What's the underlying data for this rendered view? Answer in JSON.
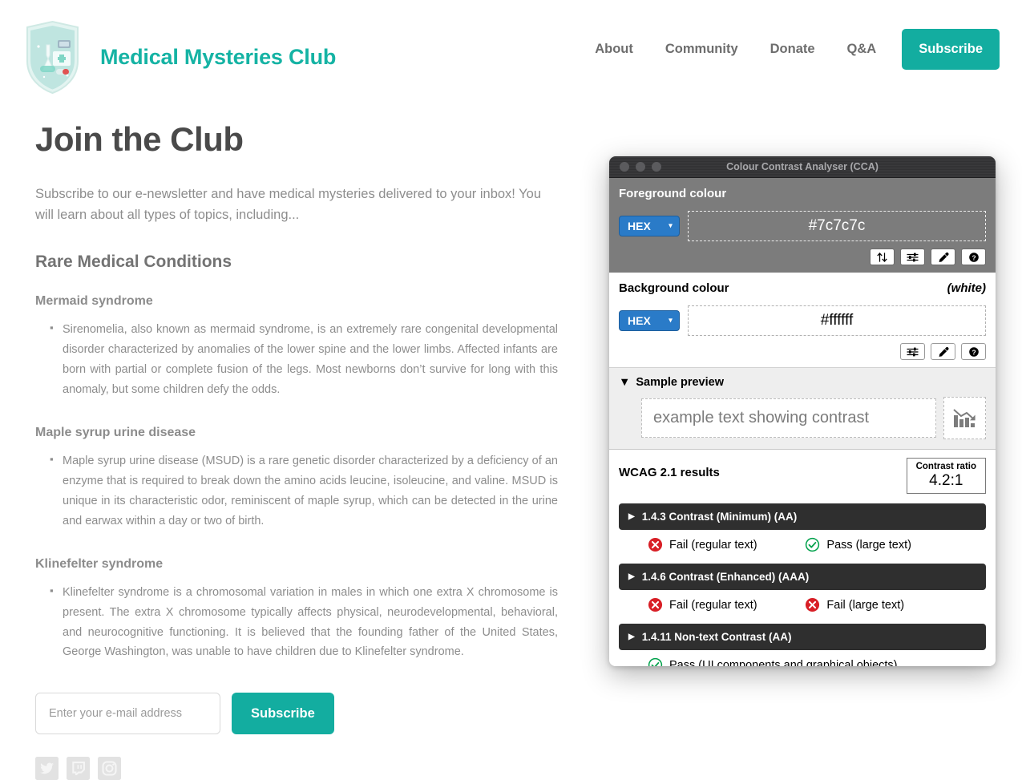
{
  "header": {
    "brand_title": "Medical Mysteries Club",
    "logo_icon": "medical-shield-logo",
    "nav": [
      {
        "label": "About"
      },
      {
        "label": "Community"
      },
      {
        "label": "Donate"
      },
      {
        "label": "Q&A"
      }
    ],
    "subscribe_button": "Subscribe",
    "accent_color": "#13ada0"
  },
  "main": {
    "page_title": "Join the Club",
    "intro": "Subscribe to our e-newsletter and have medical mysteries delivered to your inbox! You will learn about all types of topics, including...",
    "section_title": "Rare Medical Conditions",
    "conditions": [
      {
        "title": "Mermaid syndrome",
        "body": "Sirenomelia, also known as mermaid syndrome, is an extremely rare congenital developmental disorder characterized by anomalies of the lower spine and the lower limbs. Affected infants are born with partial or complete fusion of the legs. Most newborns don’t survive for long with this anomaly, but some children defy the odds."
      },
      {
        "title": "Maple syrup urine disease",
        "body": "Maple syrup urine disease (MSUD) is a rare genetic disorder characterized by a deficiency of an enzyme that is required to break down the amino acids leucine, isoleucine, and valine. MSUD is unique in its characteristic odor, reminiscent of maple syrup, which can be detected in the urine and earwax within a day or two of birth."
      },
      {
        "title": "Klinefelter syndrome",
        "body": "Klinefelter syndrome is a chromosomal variation in males in which one extra X chromosome is present. The extra X chromosome typically affects physical, neurodevelopmental, behavioral, and neurocognitive functioning. It is believed that the founding father of the United States, George Washington, was unable to have children due to Klinefelter syndrome."
      }
    ],
    "form": {
      "email_placeholder": "Enter your e-mail address",
      "email_value": "",
      "submit_label": "Subscribe"
    },
    "social": [
      {
        "name": "twitter-icon"
      },
      {
        "name": "twitch-icon"
      },
      {
        "name": "instagram-icon"
      }
    ],
    "body_text_color": "#8d8d8d"
  },
  "cca": {
    "window_title": "Colour Contrast Analyser (CCA)",
    "foreground": {
      "label": "Foreground colour",
      "format": "HEX",
      "value": "#7c7c7c",
      "buttons": [
        {
          "name": "swap-colours-icon"
        },
        {
          "name": "sliders-icon"
        },
        {
          "name": "eyedropper-icon"
        },
        {
          "name": "help-icon"
        }
      ]
    },
    "background": {
      "label": "Background colour",
      "note": "(white)",
      "format": "HEX",
      "value": "#ffffff",
      "buttons": [
        {
          "name": "sliders-icon"
        },
        {
          "name": "eyedropper-icon"
        },
        {
          "name": "help-icon"
        }
      ]
    },
    "sample": {
      "title": "Sample preview",
      "disclosure": "▼",
      "text": "example text showing contrast",
      "graphic_icon": "declining-bar-chart-icon"
    },
    "results": {
      "title": "WCAG 2.1 results",
      "ratio_label": "Contrast ratio",
      "ratio_value": "4.2:1",
      "criteria": [
        {
          "name": "1.4.3 Contrast (Minimum) (AA)",
          "outcomes": [
            {
              "status": "fail",
              "text": "Fail (regular text)"
            },
            {
              "status": "pass",
              "text": "Pass (large text)"
            }
          ]
        },
        {
          "name": "1.4.6 Contrast (Enhanced) (AAA)",
          "outcomes": [
            {
              "status": "fail",
              "text": "Fail (regular text)"
            },
            {
              "status": "fail",
              "text": "Fail (large text)"
            }
          ]
        },
        {
          "name": "1.4.11 Non-text Contrast (AA)",
          "outcomes": [
            {
              "status": "pass",
              "text": "Pass (UI components and graphical objects)"
            }
          ]
        }
      ],
      "pass_color": "#00a14b",
      "fail_color": "#d81f26"
    }
  }
}
